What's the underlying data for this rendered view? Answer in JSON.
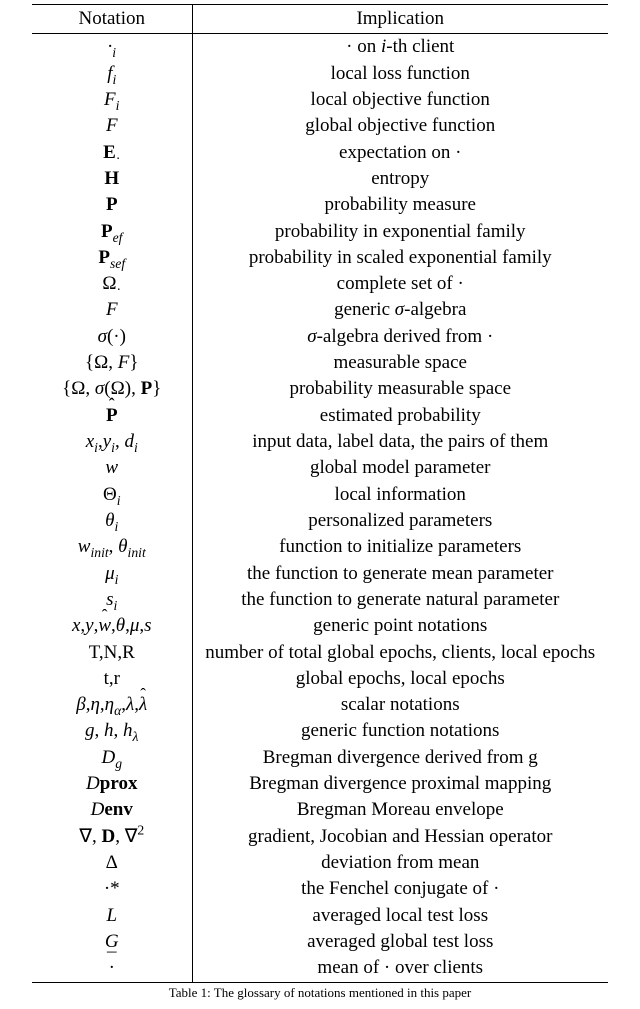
{
  "header": {
    "notation": "Notation",
    "implication": "Implication"
  },
  "rows": [
    {
      "n": "<span class='it'>·<sub>i</sub></span>",
      "i": "· on <span class='it'>i</span>-th client"
    },
    {
      "n": "<span class='it'>f<sub>i</sub></span>",
      "i": "local loss function"
    },
    {
      "n": "<span class='it'>F<sub>i</sub></span>",
      "i": "local objective function"
    },
    {
      "n": "<span class='it'>F</span>",
      "i": "global objective function"
    },
    {
      "n": "<span class='bf'>E</span><sub>·</sub>",
      "i": "expectation on ·"
    },
    {
      "n": "<span class='bf'>H</span>",
      "i": "entropy"
    },
    {
      "n": "<span class='bf'>P</span>",
      "i": "probability measure"
    },
    {
      "n": "<span class='bf'>P</span><sub><span class='it'>ef</span></sub>",
      "i": "probability in exponential family"
    },
    {
      "n": "<span class='bf'>P</span><sub><span class='it'>sef</span></sub>",
      "i": "probability in scaled exponential family"
    },
    {
      "n": "Ω<sub>·</sub>",
      "i": "complete set of ·"
    },
    {
      "n": "<span class='scr'>F</span>",
      "i": "generic <span class='it'>σ</span>-algebra"
    },
    {
      "n": "<span class='it'>σ</span>(·)",
      "i": "<span class='it'>σ</span>-algebra derived from ·"
    },
    {
      "n": "{Ω, <span class='scr'>F</span>}",
      "i": "measurable space"
    },
    {
      "n": "{Ω, <span class='it'>σ</span>(Ω), <span class='bf'>P</span>}",
      "i": "probability measurable space"
    },
    {
      "n": "<span class='hat bf'>P</span>",
      "i": "estimated probability"
    },
    {
      "n": "<span class='it'>x<sub>i</sub></span>,<span class='it'>y<sub>i</sub></span>, <span class='it'>d<sub>i</sub></span>",
      "i": "input data, label data, the pairs of them"
    },
    {
      "n": "<span class='it'>w</span>",
      "i": "global model parameter"
    },
    {
      "n": "Θ<sub><span class='it'>i</span></sub>",
      "i": "local information"
    },
    {
      "n": "<span class='it'>θ<sub>i</sub></span>",
      "i": "personalized parameters"
    },
    {
      "n": "<span class='it'>w<sub>init</sub></span>, <span class='it'>θ<sub>init</sub></span>",
      "i": "function to initialize parameters"
    },
    {
      "n": "<span class='it'>μ<sub>i</sub></span>",
      "i": "the function to generate mean parameter"
    },
    {
      "n": "<span class='it'>s<sub>i</sub></span>",
      "i": "the function to generate natural parameter"
    },
    {
      "n": "<span class='it'>x</span>,<span class='it'>y</span>,<span class='it hat'>w</span>,<span class='it'>θ</span>,<span class='it'>μ</span>,<span class='it'>s</span>",
      "i": "generic point notations"
    },
    {
      "n": "T,N,R",
      "i": "number of total global epochs, clients, local epochs"
    },
    {
      "n": "t,r",
      "i": "global epochs, local epochs"
    },
    {
      "n": "<span class='it'>β</span>,<span class='it'>η</span>,<span class='it'>η<sub>α</sub></span>,<span class='it'>λ</span>,<span class='it hat'>λ</span>",
      "i": "scalar notations"
    },
    {
      "n": "<span class='it'>g</span>, <span class='it'>h</span>, <span class='it'>h<sub>λ</sub></span>",
      "i": "generic function notations"
    },
    {
      "n": "<span class='scr'>D</span><sub><span class='it'>g</span></sub>",
      "i": "Bregman divergence derived from g"
    },
    {
      "n": "<span class='scr'>D</span><span class='bf'>prox</span>",
      "i": "Bregman divergence proximal mapping"
    },
    {
      "n": "<span class='scr'>D</span><span class='bf'>env</span>",
      "i": "Bregman Moreau envelope"
    },
    {
      "n": "∇, <span class='bf'>D</span>, ∇<sup>2</sup>",
      "i": "gradient, Jocobian and Hessian operator"
    },
    {
      "n": "Δ",
      "i": "deviation from mean"
    },
    {
      "n": "·*",
      "i": "the Fenchel conjugate of ·"
    },
    {
      "n": "<span class='scr'>L</span>",
      "i": "averaged local test loss"
    },
    {
      "n": "<span class='scr'>G</span>",
      "i": "averaged global test loss"
    },
    {
      "n": "<span class='bar'>·</span>",
      "i": "mean of · over clients"
    }
  ],
  "caption": "Table 1: The glossary of notations mentioned in this paper",
  "chart_data": {
    "type": "table",
    "title": "Table 1: The glossary of notations mentioned in this paper",
    "columns": [
      "Notation",
      "Implication"
    ],
    "rows": [
      [
        "·_i",
        "· on i-th client"
      ],
      [
        "f_i",
        "local loss function"
      ],
      [
        "F_i",
        "local objective function"
      ],
      [
        "F",
        "global objective function"
      ],
      [
        "E_·",
        "expectation on ·"
      ],
      [
        "H",
        "entropy"
      ],
      [
        "P",
        "probability measure"
      ],
      [
        "P_ef",
        "probability in exponential family"
      ],
      [
        "P_sef",
        "probability in scaled exponential family"
      ],
      [
        "Ω_·",
        "complete set of ·"
      ],
      [
        "F (script)",
        "generic σ-algebra"
      ],
      [
        "σ(·)",
        "σ-algebra derived from ·"
      ],
      [
        "{Ω, F}",
        "measurable space"
      ],
      [
        "{Ω, σ(Ω), P}",
        "probability measurable space"
      ],
      [
        "P-hat",
        "estimated probability"
      ],
      [
        "x_i, y_i, d_i",
        "input data, label data, the pairs of them"
      ],
      [
        "w",
        "global model parameter"
      ],
      [
        "Θ_i",
        "local information"
      ],
      [
        "θ_i",
        "personalized parameters"
      ],
      [
        "w_init, θ_init",
        "function to initialize parameters"
      ],
      [
        "μ_i",
        "the function to generate mean parameter"
      ],
      [
        "s_i",
        "the function to generate natural parameter"
      ],
      [
        "x, y, w-hat, θ, μ, s",
        "generic point notations"
      ],
      [
        "T, N, R",
        "number of total global epochs, clients, local epochs"
      ],
      [
        "t, r",
        "global epochs, local epochs"
      ],
      [
        "β, η, η_α, λ, λ-hat",
        "scalar notations"
      ],
      [
        "g, h, h_λ",
        "generic function notations"
      ],
      [
        "D_g",
        "Bregman divergence derived from g"
      ],
      [
        "Dprox",
        "Bregman divergence proximal mapping"
      ],
      [
        "Denv",
        "Bregman Moreau envelope"
      ],
      [
        "∇, D, ∇²",
        "gradient, Jocobian and Hessian operator"
      ],
      [
        "Δ",
        "deviation from mean"
      ],
      [
        "·*",
        "the Fenchel conjugate of ·"
      ],
      [
        "L (script)",
        "averaged local test loss"
      ],
      [
        "G (script)",
        "averaged global test loss"
      ],
      [
        "·-bar",
        "mean of · over clients"
      ]
    ]
  }
}
